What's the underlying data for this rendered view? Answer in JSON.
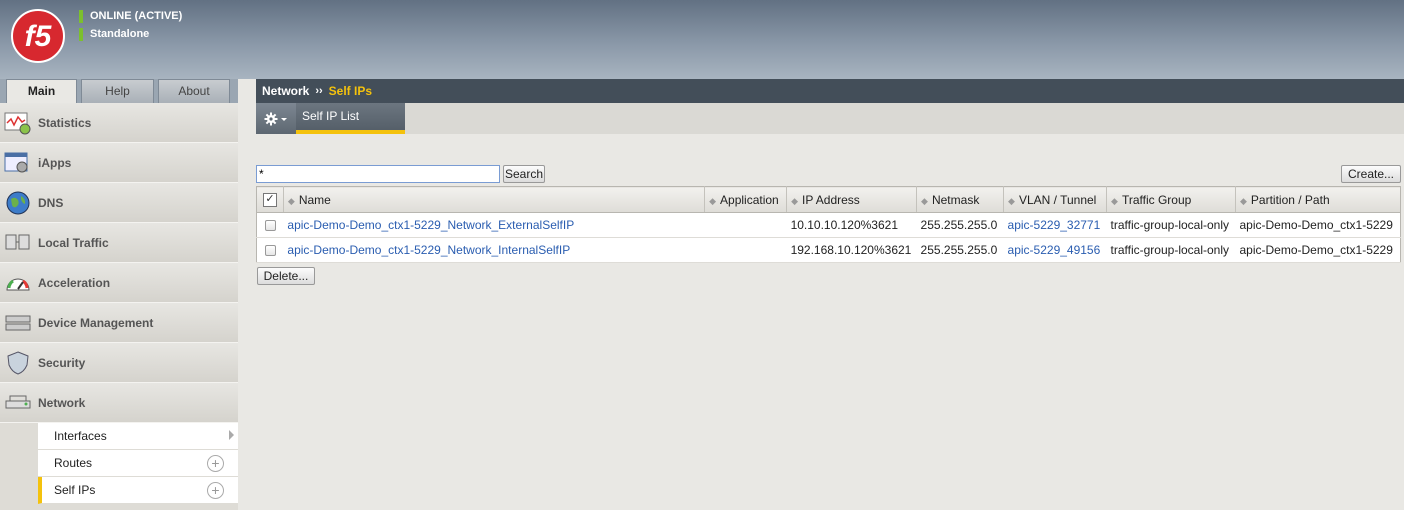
{
  "header": {
    "status": "ONLINE (ACTIVE)",
    "mode": "Standalone",
    "logo_text": "f5"
  },
  "tabs": [
    {
      "label": "Main"
    },
    {
      "label": "Help"
    },
    {
      "label": "About"
    }
  ],
  "sidebar": {
    "items": [
      {
        "label": "Statistics",
        "icon": "statistics-icon"
      },
      {
        "label": "iApps",
        "icon": "iapps-icon"
      },
      {
        "label": "DNS",
        "icon": "globe-icon"
      },
      {
        "label": "Local Traffic",
        "icon": "local-traffic-icon"
      },
      {
        "label": "Acceleration",
        "icon": "gauge-icon"
      },
      {
        "label": "Device Management",
        "icon": "device-icon"
      },
      {
        "label": "Security",
        "icon": "shield-icon"
      },
      {
        "label": "Network",
        "icon": "network-icon"
      }
    ],
    "subitems": [
      {
        "label": "Interfaces"
      },
      {
        "label": "Routes"
      },
      {
        "label": "Self IPs"
      }
    ]
  },
  "breadcrumb": {
    "section": "Network",
    "separator": "››",
    "current": "Self IPs"
  },
  "subtab": {
    "label": "Self IP List"
  },
  "search": {
    "value": "*",
    "button": "Search"
  },
  "actions": {
    "create": "Create...",
    "delete": "Delete..."
  },
  "table": {
    "columns": [
      "Name",
      "Application",
      "IP Address",
      "Netmask",
      "VLAN / Tunnel",
      "Traffic Group",
      "Partition / Path"
    ],
    "rows": [
      {
        "name": "apic-Demo-Demo_ctx1-5229_Network_ExternalSelfIP",
        "application": "",
        "ip": "10.10.10.120%3621",
        "netmask": "255.255.255.0",
        "vlan": "apic-5229_32771",
        "traffic_group": "traffic-group-local-only",
        "partition": "apic-Demo-Demo_ctx1-5229"
      },
      {
        "name": "apic-Demo-Demo_ctx1-5229_Network_InternalSelfIP",
        "application": "",
        "ip": "192.168.10.120%3621",
        "netmask": "255.255.255.0",
        "vlan": "apic-5229_49156",
        "traffic_group": "traffic-group-local-only",
        "partition": "apic-Demo-Demo_ctx1-5229"
      }
    ]
  },
  "colors": {
    "accent": "#f4c20d",
    "status_green": "#7cc02e",
    "link": "#2a5db0",
    "logo_red": "#d7282f"
  }
}
